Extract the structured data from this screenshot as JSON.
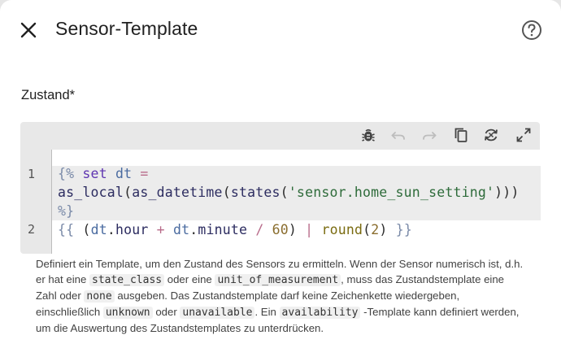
{
  "dialog": {
    "title": "Sensor-Template",
    "close_icon": "close-icon",
    "help_icon": "help-circle-icon"
  },
  "field": {
    "label": "Zustand*"
  },
  "toolbar": {
    "icons": [
      "bug-icon",
      "undo-icon",
      "redo-icon",
      "copy-icon",
      "refresh-render-icon",
      "fullscreen-icon"
    ]
  },
  "editor": {
    "line1_number": "1",
    "line2_number": "2",
    "line1_part1_open": "{%",
    "line1_part1_kw": "set",
    "line1_part1_var": "dt",
    "line1_part1_eq": "=",
    "line1_part2_fn1": "as_local",
    "line1_part2_fn2": "as_datetime",
    "line1_part2_fn3": "states",
    "line1_part2_str": "'sensor.home_sun_setting'",
    "line1_part2_close": ")))",
    "line1_part3_close": "%}",
    "line2_open": "{{",
    "line2_dt1": "dt",
    "line2_attr1": "hour",
    "line2_plus": "+",
    "line2_dt2": "dt",
    "line2_attr2": "minute",
    "line2_div": "/",
    "line2_num60": "60",
    "line2_pipe": "|",
    "line2_round": "round",
    "line2_num2": "2",
    "line2_close": "}}"
  },
  "helper": {
    "t1": "Definiert ein Template, um den Zustand des Sensors zu ermitteln. Wenn der Sensor numerisch ist, d.h. er hat eine",
    "c1": "state_class",
    "t2": "oder eine",
    "c2": "unit_of_measurement",
    "t3": ", muss das Zustandstemplate eine Zahl oder",
    "c3": "none",
    "t4": "ausgeben. Das Zustandstemplate darf keine Zeichenkette wiedergeben, einschließlich",
    "c4": "unknown",
    "t5": "oder",
    "c5": "unavailable",
    "t6": ". Ein",
    "c6": "availability",
    "t7": "-Template kann definiert werden, um die Auswertung des Zustandstemplates zu unterdrücken."
  }
}
